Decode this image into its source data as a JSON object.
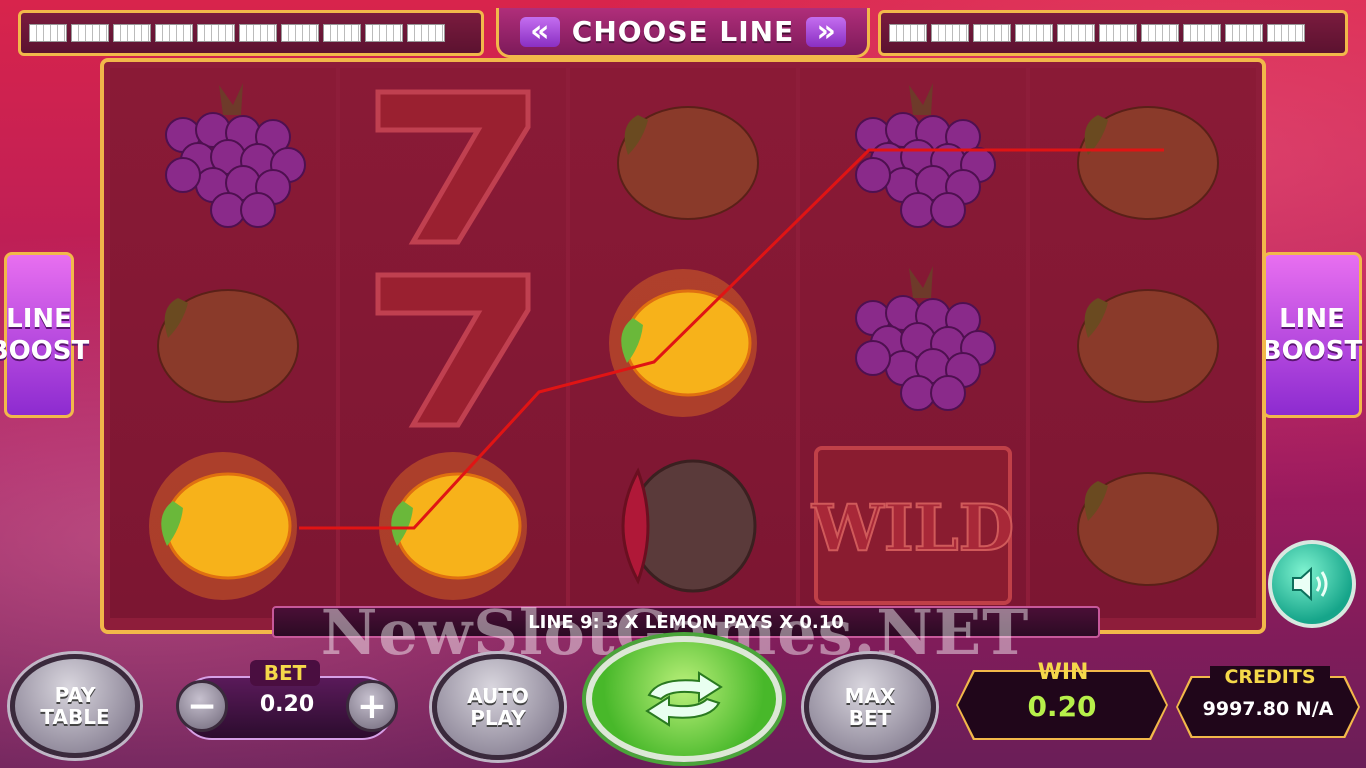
{
  "header": {
    "choose_line_label": "CHOOSE LINE",
    "prev_arrow": "«",
    "next_arrow": "»",
    "left_line_count": 10,
    "right_line_count": 10
  },
  "side": {
    "left_boost_line1": "LINE",
    "left_boost_line2": "BOOST",
    "right_boost_line1": "LINE",
    "right_boost_line2": "BOOST"
  },
  "reels": [
    [
      "grapes",
      "lemon",
      "lemon-glow"
    ],
    [
      "seven",
      "seven",
      "lemon-glow"
    ],
    [
      "lemon",
      "lemon-glow",
      "watermelon"
    ],
    [
      "grapes",
      "grapes",
      "wild"
    ],
    [
      "lemon",
      "lemon",
      "lemon"
    ]
  ],
  "wild_text": "WILD",
  "message": "LINE 9: 3 X LEMON PAYS X 0.10",
  "watermark": "NewSlotGames.NET",
  "controls": {
    "paytable_line1": "PAY",
    "paytable_line2": "TABLE",
    "bet_label": "BET",
    "bet_value": "0.20",
    "minus": "−",
    "plus": "+",
    "autoplay_line1": "AUTO",
    "autoplay_line2": "PLAY",
    "maxbet_line1": "MAX",
    "maxbet_line2": "BET",
    "win_label": "WIN",
    "win_value": "0.20",
    "credits_label": "CREDITS",
    "credits_value": "9997.80 N/A"
  },
  "colors": {
    "accent_gold": "#f2b84a",
    "payline": "#e01414",
    "win_value": "#b7f04a"
  }
}
